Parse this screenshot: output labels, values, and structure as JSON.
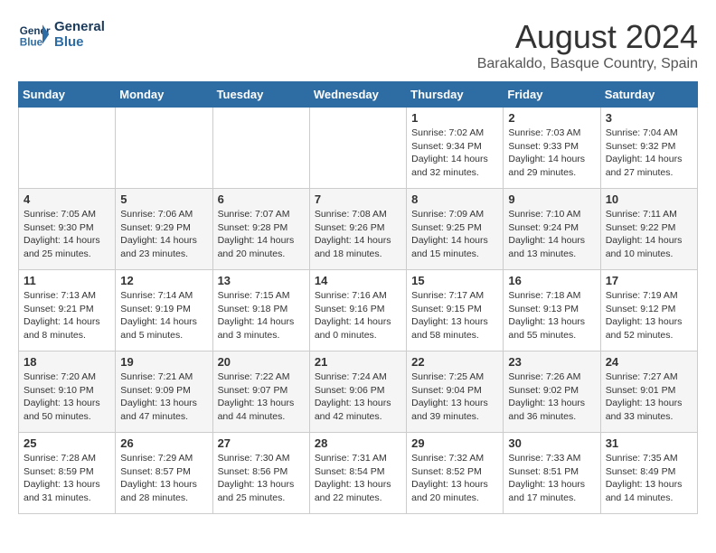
{
  "header": {
    "logo_line1": "General",
    "logo_line2": "Blue",
    "title": "August 2024",
    "subtitle": "Barakaldo, Basque Country, Spain"
  },
  "days_of_week": [
    "Sunday",
    "Monday",
    "Tuesday",
    "Wednesday",
    "Thursday",
    "Friday",
    "Saturday"
  ],
  "weeks": [
    [
      {
        "day": "",
        "info": ""
      },
      {
        "day": "",
        "info": ""
      },
      {
        "day": "",
        "info": ""
      },
      {
        "day": "",
        "info": ""
      },
      {
        "day": "1",
        "info": "Sunrise: 7:02 AM\nSunset: 9:34 PM\nDaylight: 14 hours\nand 32 minutes."
      },
      {
        "day": "2",
        "info": "Sunrise: 7:03 AM\nSunset: 9:33 PM\nDaylight: 14 hours\nand 29 minutes."
      },
      {
        "day": "3",
        "info": "Sunrise: 7:04 AM\nSunset: 9:32 PM\nDaylight: 14 hours\nand 27 minutes."
      }
    ],
    [
      {
        "day": "4",
        "info": "Sunrise: 7:05 AM\nSunset: 9:30 PM\nDaylight: 14 hours\nand 25 minutes."
      },
      {
        "day": "5",
        "info": "Sunrise: 7:06 AM\nSunset: 9:29 PM\nDaylight: 14 hours\nand 23 minutes."
      },
      {
        "day": "6",
        "info": "Sunrise: 7:07 AM\nSunset: 9:28 PM\nDaylight: 14 hours\nand 20 minutes."
      },
      {
        "day": "7",
        "info": "Sunrise: 7:08 AM\nSunset: 9:26 PM\nDaylight: 14 hours\nand 18 minutes."
      },
      {
        "day": "8",
        "info": "Sunrise: 7:09 AM\nSunset: 9:25 PM\nDaylight: 14 hours\nand 15 minutes."
      },
      {
        "day": "9",
        "info": "Sunrise: 7:10 AM\nSunset: 9:24 PM\nDaylight: 14 hours\nand 13 minutes."
      },
      {
        "day": "10",
        "info": "Sunrise: 7:11 AM\nSunset: 9:22 PM\nDaylight: 14 hours\nand 10 minutes."
      }
    ],
    [
      {
        "day": "11",
        "info": "Sunrise: 7:13 AM\nSunset: 9:21 PM\nDaylight: 14 hours\nand 8 minutes."
      },
      {
        "day": "12",
        "info": "Sunrise: 7:14 AM\nSunset: 9:19 PM\nDaylight: 14 hours\nand 5 minutes."
      },
      {
        "day": "13",
        "info": "Sunrise: 7:15 AM\nSunset: 9:18 PM\nDaylight: 14 hours\nand 3 minutes."
      },
      {
        "day": "14",
        "info": "Sunrise: 7:16 AM\nSunset: 9:16 PM\nDaylight: 14 hours\nand 0 minutes."
      },
      {
        "day": "15",
        "info": "Sunrise: 7:17 AM\nSunset: 9:15 PM\nDaylight: 13 hours\nand 58 minutes."
      },
      {
        "day": "16",
        "info": "Sunrise: 7:18 AM\nSunset: 9:13 PM\nDaylight: 13 hours\nand 55 minutes."
      },
      {
        "day": "17",
        "info": "Sunrise: 7:19 AM\nSunset: 9:12 PM\nDaylight: 13 hours\nand 52 minutes."
      }
    ],
    [
      {
        "day": "18",
        "info": "Sunrise: 7:20 AM\nSunset: 9:10 PM\nDaylight: 13 hours\nand 50 minutes."
      },
      {
        "day": "19",
        "info": "Sunrise: 7:21 AM\nSunset: 9:09 PM\nDaylight: 13 hours\nand 47 minutes."
      },
      {
        "day": "20",
        "info": "Sunrise: 7:22 AM\nSunset: 9:07 PM\nDaylight: 13 hours\nand 44 minutes."
      },
      {
        "day": "21",
        "info": "Sunrise: 7:24 AM\nSunset: 9:06 PM\nDaylight: 13 hours\nand 42 minutes."
      },
      {
        "day": "22",
        "info": "Sunrise: 7:25 AM\nSunset: 9:04 PM\nDaylight: 13 hours\nand 39 minutes."
      },
      {
        "day": "23",
        "info": "Sunrise: 7:26 AM\nSunset: 9:02 PM\nDaylight: 13 hours\nand 36 minutes."
      },
      {
        "day": "24",
        "info": "Sunrise: 7:27 AM\nSunset: 9:01 PM\nDaylight: 13 hours\nand 33 minutes."
      }
    ],
    [
      {
        "day": "25",
        "info": "Sunrise: 7:28 AM\nSunset: 8:59 PM\nDaylight: 13 hours\nand 31 minutes."
      },
      {
        "day": "26",
        "info": "Sunrise: 7:29 AM\nSunset: 8:57 PM\nDaylight: 13 hours\nand 28 minutes."
      },
      {
        "day": "27",
        "info": "Sunrise: 7:30 AM\nSunset: 8:56 PM\nDaylight: 13 hours\nand 25 minutes."
      },
      {
        "day": "28",
        "info": "Sunrise: 7:31 AM\nSunset: 8:54 PM\nDaylight: 13 hours\nand 22 minutes."
      },
      {
        "day": "29",
        "info": "Sunrise: 7:32 AM\nSunset: 8:52 PM\nDaylight: 13 hours\nand 20 minutes."
      },
      {
        "day": "30",
        "info": "Sunrise: 7:33 AM\nSunset: 8:51 PM\nDaylight: 13 hours\nand 17 minutes."
      },
      {
        "day": "31",
        "info": "Sunrise: 7:35 AM\nSunset: 8:49 PM\nDaylight: 13 hours\nand 14 minutes."
      }
    ]
  ]
}
